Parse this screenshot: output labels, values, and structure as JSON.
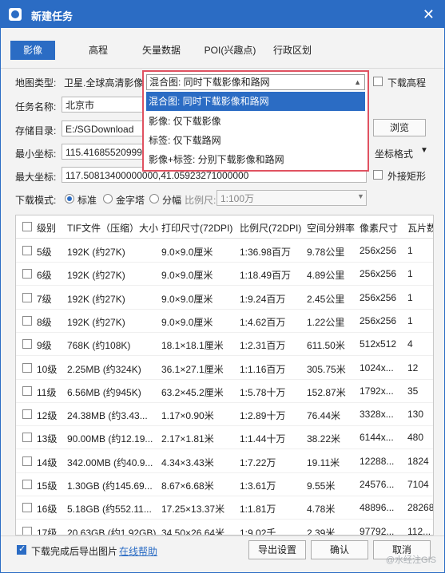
{
  "window": {
    "title": "新建任务",
    "close": "✕"
  },
  "tabs": [
    {
      "label": "影像",
      "active": true
    },
    {
      "label": "高程"
    },
    {
      "label": "矢量数据"
    },
    {
      "label": "POI(兴趣点)"
    },
    {
      "label": "行政区划"
    }
  ],
  "form": {
    "map_type_label": "地图类型:",
    "map_type_value": "卫星.全球高清影像",
    "task_name_label": "任务名称:",
    "task_name_value": "北京市",
    "storage_label": "存储目录:",
    "storage_value": "E:/SGDownload",
    "browse_label": "浏览",
    "min_coord_label": "最小坐标:",
    "min_coord_value": "115.41685520999",
    "max_coord_label": "最大坐标:",
    "max_coord_value": "117.50813400000000,41.05923271000000",
    "coord_format_label": "坐标格式",
    "download_elevation_label": "下载高程",
    "outer_rect_label": "外接矩形",
    "mode_label": "下载模式:",
    "mode_options": [
      "标准",
      "金字塔",
      "分幅"
    ],
    "scale_label": "比例尺:",
    "scale_value": "1:100万"
  },
  "dropdown": {
    "current": "混合图: 同时下载影像和路网",
    "options": [
      "混合图: 同时下载影像和路网",
      "影像: 仅下载影像",
      "标签: 仅下载路网",
      "影像+标签: 分别下载影像和路网"
    ]
  },
  "table": {
    "headers": [
      "级别",
      "TIF文件（压缩）大小",
      "打印尺寸(72DPI)",
      "比例尺(72DPI)",
      "空间分辨率",
      "像素尺寸",
      "瓦片数"
    ],
    "rows": [
      [
        "5级",
        "192K (约27K)",
        "9.0×9.0厘米",
        "1:36.98百万",
        "9.78公里",
        "256x256",
        "1"
      ],
      [
        "6级",
        "192K (约27K)",
        "9.0×9.0厘米",
        "1:18.49百万",
        "4.89公里",
        "256x256",
        "1"
      ],
      [
        "7级",
        "192K (约27K)",
        "9.0×9.0厘米",
        "1:9.24百万",
        "2.45公里",
        "256x256",
        "1"
      ],
      [
        "8级",
        "192K (约27K)",
        "9.0×9.0厘米",
        "1:4.62百万",
        "1.22公里",
        "256x256",
        "1"
      ],
      [
        "9级",
        "768K (约108K)",
        "18.1×18.1厘米",
        "1:2.31百万",
        "611.50米",
        "512x512",
        "4"
      ],
      [
        "10级",
        "2.25MB (约324K)",
        "36.1×27.1厘米",
        "1:1.16百万",
        "305.75米",
        "1024x...",
        "12"
      ],
      [
        "11级",
        "6.56MB (约945K)",
        "63.2×45.2厘米",
        "1:5.78十万",
        "152.87米",
        "1792x...",
        "35"
      ],
      [
        "12级",
        "24.38MB (约3.43...",
        "1.17×0.90米",
        "1:2.89十万",
        "76.44米",
        "3328x...",
        "130"
      ],
      [
        "13级",
        "90.00MB (约12.19...",
        "2.17×1.81米",
        "1:1.44十万",
        "38.22米",
        "6144x...",
        "480"
      ],
      [
        "14级",
        "342.00MB (约40.9...",
        "4.34×3.43米",
        "1:7.22万",
        "19.11米",
        "12288...",
        "1824"
      ],
      [
        "15级",
        "1.30GB (约145.69...",
        "8.67×6.68米",
        "1:3.61万",
        "9.55米",
        "24576...",
        "7104"
      ],
      [
        "16级",
        "5.18GB (约552.11...",
        "17.25×13.37米",
        "1:1.81万",
        "4.78米",
        "48896...",
        "28268"
      ],
      [
        "17级",
        "20.63GB (约1.92GB)",
        "34.50×26.64米",
        "1:9.02千",
        "2.39米",
        "97792...",
        "112..."
      ]
    ]
  },
  "footer": {
    "export_label": "下载完成后导出图片",
    "help_label": "在线帮助",
    "export_settings": "导出设置",
    "ok": "确认",
    "cancel": "取消"
  },
  "watermark": "@水经注GIS",
  "colors": {
    "accent": "#2b6cc4",
    "highlight_border": "#e05261"
  }
}
